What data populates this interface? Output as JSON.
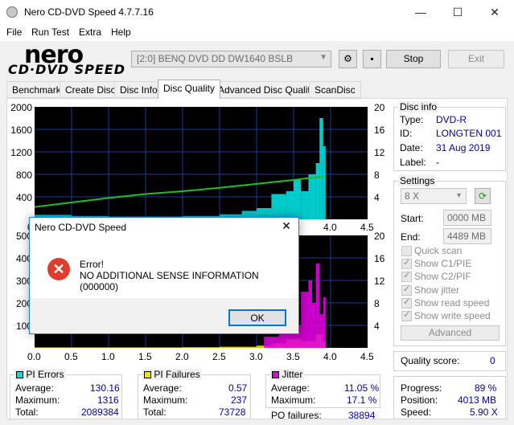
{
  "window": {
    "title": "Nero CD-DVD Speed 4.7.7.16",
    "min_glyph": "—",
    "max_glyph": "☐",
    "close_glyph": "✕"
  },
  "menu": [
    "File",
    "Run Test",
    "Extra",
    "Help"
  ],
  "logo": {
    "line1": "nero",
    "line2": "CD·DVD SPEED"
  },
  "toolbar": {
    "drive": "[2:0]   BENQ DVD DD DW1640 BSLB",
    "stop_label": "Stop",
    "exit_label": "Exit"
  },
  "tabs": [
    "Benchmark",
    "Create Disc",
    "Disc Info",
    "Disc Quality",
    "Advanced Disc Quality",
    "ScanDisc"
  ],
  "active_tab": "Disc Quality",
  "disc_info": {
    "title": "Disc info",
    "type_label": "Type:",
    "type": "DVD-R",
    "id_label": "ID:",
    "id": "LONGTEN 001",
    "date_label": "Date:",
    "date": "31 Aug 2019",
    "label_label": "Label:",
    "label": "-"
  },
  "settings": {
    "title": "Settings",
    "speed": "8 X",
    "start_label": "Start:",
    "start": "0000 MB",
    "end_label": "End:",
    "end": "4489 MB",
    "checkboxes": [
      {
        "label": "Quick scan",
        "checked": false
      },
      {
        "label": "Show C1/PIE",
        "checked": true
      },
      {
        "label": "Show C2/PIF",
        "checked": true
      },
      {
        "label": "Show jitter",
        "checked": true
      },
      {
        "label": "Show read speed",
        "checked": true
      },
      {
        "label": "Show write speed",
        "checked": true
      }
    ],
    "advanced_label": "Advanced"
  },
  "quality": {
    "label": "Quality score:",
    "value": "0"
  },
  "progress": {
    "progress_label": "Progress:",
    "progress": "89 %",
    "position_label": "Position:",
    "position": "4013 MB",
    "speed_label": "Speed:",
    "speed": "5.90 X"
  },
  "stats": {
    "pi_errors": {
      "title": "PI Errors",
      "avg_label": "Average:",
      "avg": "130.16",
      "max_label": "Maximum:",
      "max": "1316",
      "total_label": "Total:",
      "total": "2089384",
      "color": "#00e0e0"
    },
    "pi_failures": {
      "title": "PI Failures",
      "avg_label": "Average:",
      "avg": "0.57",
      "max_label": "Maximum:",
      "max": "237",
      "total_label": "Total:",
      "total": "73728",
      "color": "#e8e800"
    },
    "jitter": {
      "title": "Jitter",
      "avg_label": "Average:",
      "avg": "11.05 %",
      "max_label": "Maximum:",
      "max": "17.1 %",
      "po_label": "PO failures:",
      "po": "38894",
      "color": "#e000e0"
    }
  },
  "dialog": {
    "title": "Nero CD-DVD Speed",
    "close_glyph": "✕",
    "line1": "Error!",
    "line2": "NO ADDITIONAL SENSE INFORMATION (000000)",
    "ok_label": "OK"
  },
  "chart_data": [
    {
      "type": "area",
      "name": "PI errors / read speed",
      "x_ticks": [
        "0.0",
        "0.5",
        "1.0",
        "1.5",
        "2.0",
        "2.5",
        "3.0",
        "3.5",
        "4.0",
        "4.5"
      ],
      "left_ticks": [
        "2000",
        "1600",
        "1200",
        "800",
        "400"
      ],
      "right_ticks": [
        "20",
        "16",
        "12",
        "8",
        "4"
      ],
      "ylim": [
        0,
        2000
      ],
      "y2lim": [
        0,
        20
      ],
      "xlim": [
        0,
        4.5
      ],
      "series": [
        {
          "name": "PI Errors",
          "color": "#00e0e0",
          "x": [
            0.0,
            0.5,
            1.0,
            1.5,
            2.0,
            2.5,
            2.8,
            3.0,
            3.2,
            3.4,
            3.5,
            3.6,
            3.7,
            3.8,
            3.85,
            3.9
          ],
          "values": [
            80,
            60,
            50,
            50,
            60,
            90,
            150,
            200,
            450,
            500,
            700,
            500,
            800,
            1000,
            1800,
            1300
          ]
        },
        {
          "name": "Read speed",
          "color": "#20c020",
          "x": [
            0.0,
            0.5,
            1.0,
            1.5,
            2.0,
            2.5,
            3.0,
            3.5,
            3.8,
            3.9
          ],
          "values": [
            2.2,
            3.0,
            3.8,
            4.5,
            5.0,
            5.6,
            6.3,
            7.0,
            7.5,
            7.6
          ]
        }
      ]
    },
    {
      "type": "area",
      "name": "PI failures / jitter",
      "x_ticks": [
        "0.0",
        "0.5",
        "1.0",
        "1.5",
        "2.0",
        "2.5",
        "3.0",
        "3.5",
        "4.0",
        "4.5"
      ],
      "left_ticks": [
        "500",
        "400",
        "300",
        "200",
        "100"
      ],
      "right_ticks": [
        "20",
        "16",
        "12",
        "8",
        "4"
      ],
      "ylim": [
        0,
        500
      ],
      "y2lim": [
        0,
        20
      ],
      "xlim": [
        0,
        4.5
      ],
      "series": [
        {
          "name": "PI Failures",
          "color": "#e8e800",
          "x": [
            0.0,
            0.5,
            1.0,
            1.5,
            2.0,
            2.5,
            3.0,
            3.2,
            3.4,
            3.6,
            3.8,
            3.9
          ],
          "values": [
            2,
            2,
            2,
            2,
            3,
            5,
            10,
            20,
            40,
            30,
            60,
            30
          ]
        },
        {
          "name": "Jitter",
          "color": "#e000e0",
          "x": [
            3.1,
            3.3,
            3.5,
            3.6,
            3.7,
            3.75,
            3.8,
            3.85,
            3.9
          ],
          "values": [
            2,
            3,
            4,
            10,
            12,
            8,
            15,
            6,
            9
          ]
        }
      ]
    }
  ]
}
